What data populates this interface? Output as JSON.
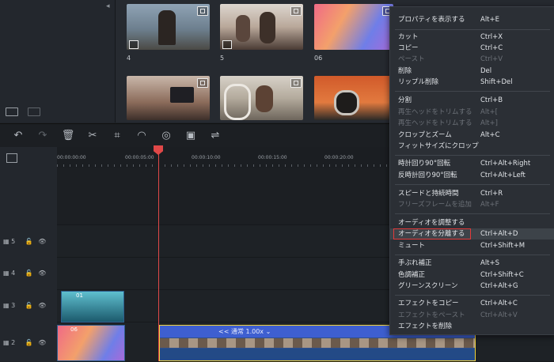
{
  "library": {
    "thumbs": [
      {
        "label": "4"
      },
      {
        "label": "5"
      },
      {
        "label": "06"
      }
    ]
  },
  "timeline": {
    "ticks": [
      "00:00:00:00",
      "00:00:05:00",
      "00:00:10:00",
      "00:00:15:00",
      "00:00:20:00"
    ],
    "tracks": [
      "5",
      "4",
      "3",
      "2"
    ],
    "clips": {
      "track3_label": "01",
      "track2_label": "06",
      "speed_label": "<< 通常 1.00x"
    }
  },
  "menu": {
    "items": [
      {
        "label": "プロパティを表示する",
        "shortcut": "Alt+E",
        "enabled": true
      },
      {
        "label": "カット",
        "shortcut": "Ctrl+X",
        "enabled": true
      },
      {
        "label": "コピー",
        "shortcut": "Ctrl+C",
        "enabled": true
      },
      {
        "label": "ペースト",
        "shortcut": "Ctrl+V",
        "enabled": false
      },
      {
        "label": "削除",
        "shortcut": "Del",
        "enabled": true
      },
      {
        "label": "リップル削除",
        "shortcut": "Shift+Del",
        "enabled": true
      },
      {
        "label": "分割",
        "shortcut": "Ctrl+B",
        "enabled": true
      },
      {
        "label": "再生ヘッドをトリムする",
        "shortcut": "Alt+[",
        "enabled": false
      },
      {
        "label": "再生ヘッドをトリムする",
        "shortcut": "Alt+]",
        "enabled": false
      },
      {
        "label": "クロップとズーム",
        "shortcut": "Alt+C",
        "enabled": true
      },
      {
        "label": "フィットサイズにクロップ",
        "shortcut": "",
        "enabled": true
      },
      {
        "label": "時計回り90°回転",
        "shortcut": "Ctrl+Alt+Right",
        "enabled": true
      },
      {
        "label": "反時計回り90°回転",
        "shortcut": "Ctrl+Alt+Left",
        "enabled": true
      },
      {
        "label": "スピードと持続時間",
        "shortcut": "Ctrl+R",
        "enabled": true
      },
      {
        "label": "フリーズフレームを追加",
        "shortcut": "Alt+F",
        "enabled": false
      },
      {
        "label": "オーディオを調整する",
        "shortcut": "",
        "enabled": true
      },
      {
        "label": "オーディオを分離する",
        "shortcut": "Ctrl+Alt+D",
        "enabled": true
      },
      {
        "label": "ミュート",
        "shortcut": "Ctrl+Shift+M",
        "enabled": true
      },
      {
        "label": "手ぶれ補正",
        "shortcut": "Alt+S",
        "enabled": true
      },
      {
        "label": "色調補正",
        "shortcut": "Ctrl+Shift+C",
        "enabled": true
      },
      {
        "label": "グリーンスクリーン",
        "shortcut": "Ctrl+Alt+G",
        "enabled": true
      },
      {
        "label": "エフェクトをコピー",
        "shortcut": "Ctrl+Alt+C",
        "enabled": true
      },
      {
        "label": "エフェクトをペースト",
        "shortcut": "Ctrl+Alt+V",
        "enabled": false
      },
      {
        "label": "エフェクトを削除",
        "shortcut": "",
        "enabled": true
      }
    ]
  }
}
